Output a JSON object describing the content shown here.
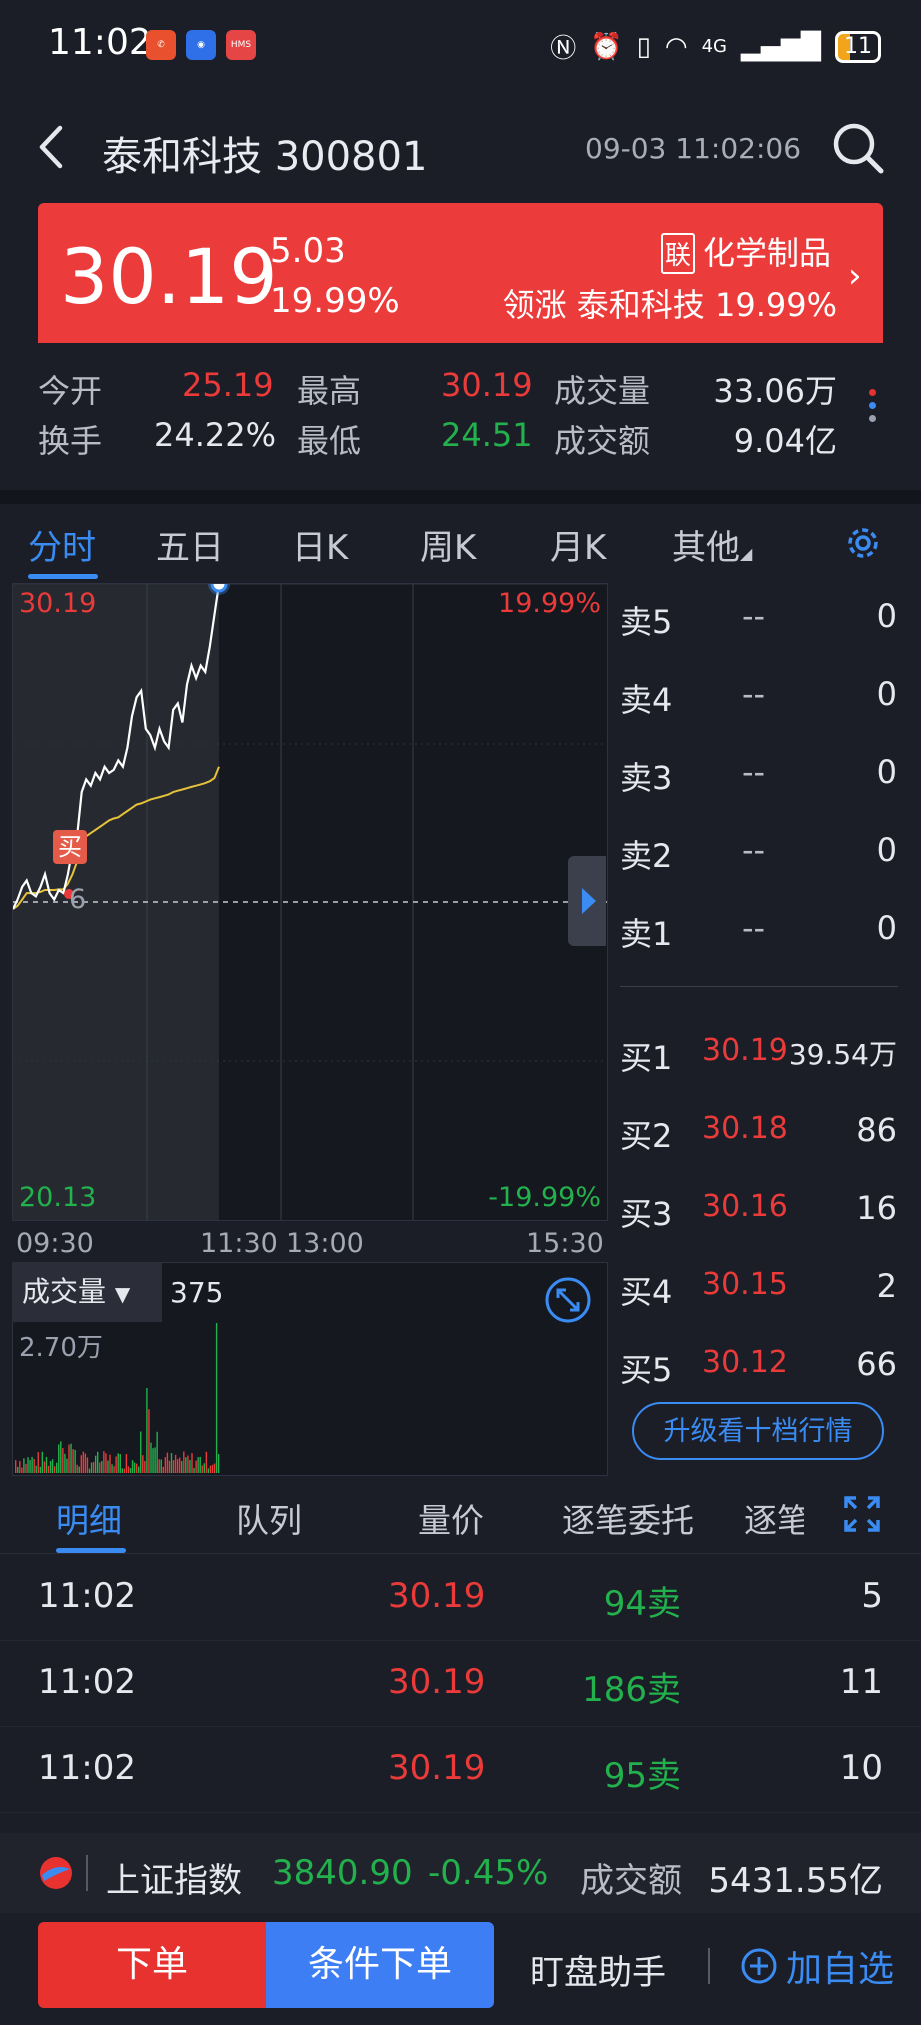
{
  "status": {
    "time": "11:02",
    "app_icon_3": "HMS",
    "network": "4G",
    "battery": "11"
  },
  "header": {
    "back_icon": "back-arrow-icon",
    "title": "泰和科技 300801",
    "datetime": "09-03 11:02:06"
  },
  "quote": {
    "price": "30.19",
    "change": "5.03",
    "change_pct": "19.99%",
    "sector_tag": "联",
    "sector": "化学制品",
    "leader_label": "领涨",
    "leader_name": "泰和科技",
    "leader_pct": "19.99%",
    "accent_up": "#ea3a3a",
    "accent_down": "#22b14c"
  },
  "stats": {
    "open_label": "今开",
    "open": "25.19",
    "high_label": "最高",
    "high": "30.19",
    "volume_label": "成交量",
    "volume": "33.06万",
    "turnover_label": "换手",
    "turnover": "24.22%",
    "low_label": "最低",
    "low": "24.51",
    "amount_label": "成交额",
    "amount": "9.04亿"
  },
  "tabs": [
    "分时",
    "五日",
    "日K",
    "周K",
    "月K",
    "其他"
  ],
  "chart": {
    "top_price": "30.19",
    "top_pct": "19.99%",
    "bottom_price": "20.13",
    "bottom_pct": "-19.99%",
    "ref_label": "6",
    "buy_marker": "买",
    "times": [
      "09:30",
      "11:30",
      "13:00",
      "15:30"
    ],
    "volume_label": "成交量",
    "volume_value": "375",
    "volume_max": "2.70万"
  },
  "chart_data": {
    "type": "line",
    "title": "",
    "ylim": [
      20.13,
      30.19
    ],
    "series": [
      {
        "values": [
          25.05,
          25.2,
          25.4,
          25.5,
          25.3,
          25.25,
          25.4,
          25.6,
          25.3,
          25.2,
          25.35,
          25.3,
          25.6,
          26.0,
          26.2,
          26.9,
          27.1,
          27.0,
          27.2,
          27.1,
          27.3,
          27.2,
          27.25,
          27.4,
          27.3,
          27.6,
          28.1,
          28.4,
          28.5,
          27.9,
          27.8,
          27.6,
          27.9,
          27.7,
          27.6,
          28.2,
          28.3,
          28.0,
          28.6,
          28.9,
          28.7,
          28.9,
          28.8,
          29.2,
          29.7,
          30.19
        ]
      },
      {
        "values": [
          25.05,
          25.1,
          25.2,
          25.3,
          25.3,
          25.3,
          25.32,
          25.35,
          25.35,
          25.35,
          25.36,
          25.36,
          25.45,
          25.6,
          25.8,
          26.05,
          26.2,
          26.25,
          26.3,
          26.35,
          26.4,
          26.45,
          26.48,
          26.5,
          26.55,
          26.6,
          26.65,
          26.7,
          26.72,
          26.75,
          26.78,
          26.8,
          26.82,
          26.84,
          26.86,
          26.9,
          26.92,
          26.94,
          26.96,
          26.98,
          27.0,
          27.02,
          27.04,
          27.07,
          27.12,
          27.3
        ]
      }
    ]
  },
  "orderbook": {
    "sells": [
      {
        "label": "卖5",
        "price": "--",
        "vol": "0"
      },
      {
        "label": "卖4",
        "price": "--",
        "vol": "0"
      },
      {
        "label": "卖3",
        "price": "--",
        "vol": "0"
      },
      {
        "label": "卖2",
        "price": "--",
        "vol": "0"
      },
      {
        "label": "卖1",
        "price": "--",
        "vol": "0"
      }
    ],
    "buys": [
      {
        "label": "买1",
        "price": "30.19",
        "vol": "39.54万"
      },
      {
        "label": "买2",
        "price": "30.18",
        "vol": "86"
      },
      {
        "label": "买3",
        "price": "30.16",
        "vol": "16"
      },
      {
        "label": "买4",
        "price": "30.15",
        "vol": "2"
      },
      {
        "label": "买5",
        "price": "30.12",
        "vol": "66"
      }
    ],
    "upgrade": "升级看十档行情"
  },
  "detail_tabs": [
    "明细",
    "队列",
    "量价",
    "逐笔委托",
    "逐笔"
  ],
  "trades": [
    {
      "time": "11:02",
      "price": "30.19",
      "qty": "94卖",
      "count": "5"
    },
    {
      "time": "11:02",
      "price": "30.19",
      "qty": "186卖",
      "count": "11"
    },
    {
      "time": "11:02",
      "price": "30.19",
      "qty": "95卖",
      "count": "10"
    }
  ],
  "index": {
    "name": "上证指数",
    "value": "3840.90",
    "pct": "-0.45%",
    "amount_label": "成交额",
    "amount": "5431.55亿"
  },
  "bottom": {
    "order": "下单",
    "conditional": "条件下单",
    "assistant": "盯盘助手",
    "favorite": "加自选"
  }
}
